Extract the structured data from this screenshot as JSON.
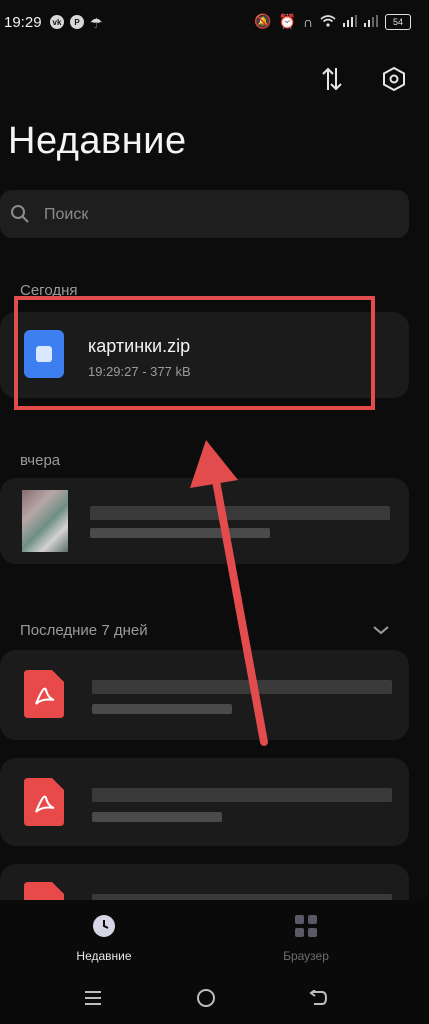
{
  "status_bar": {
    "time": "19:29",
    "left_icons": [
      "vk-icon",
      "pinterest-icon",
      "umbrella-icon"
    ],
    "battery": "54"
  },
  "toolbar": {
    "sort_icon": "sort-icon",
    "settings_icon": "settings-icon"
  },
  "page": {
    "title": "Недавние"
  },
  "search": {
    "placeholder": "Поиск",
    "value": ""
  },
  "sections": {
    "today": "Сегодня",
    "yesterday": "вчера",
    "last7": "Последние 7 дней"
  },
  "files": {
    "zip": {
      "name": "картинки.zip",
      "meta": "19:29:27 - 377 kB",
      "icon": "zip-icon"
    }
  },
  "bottom_nav": {
    "recent": "Недавние",
    "browser": "Браузер"
  },
  "colors": {
    "background": "#0c0c0c",
    "card": "#1b1b1b",
    "zip_icon": "#3d7ff0",
    "pdf_icon": "#e84a4a",
    "highlight": "#e24c4c"
  }
}
